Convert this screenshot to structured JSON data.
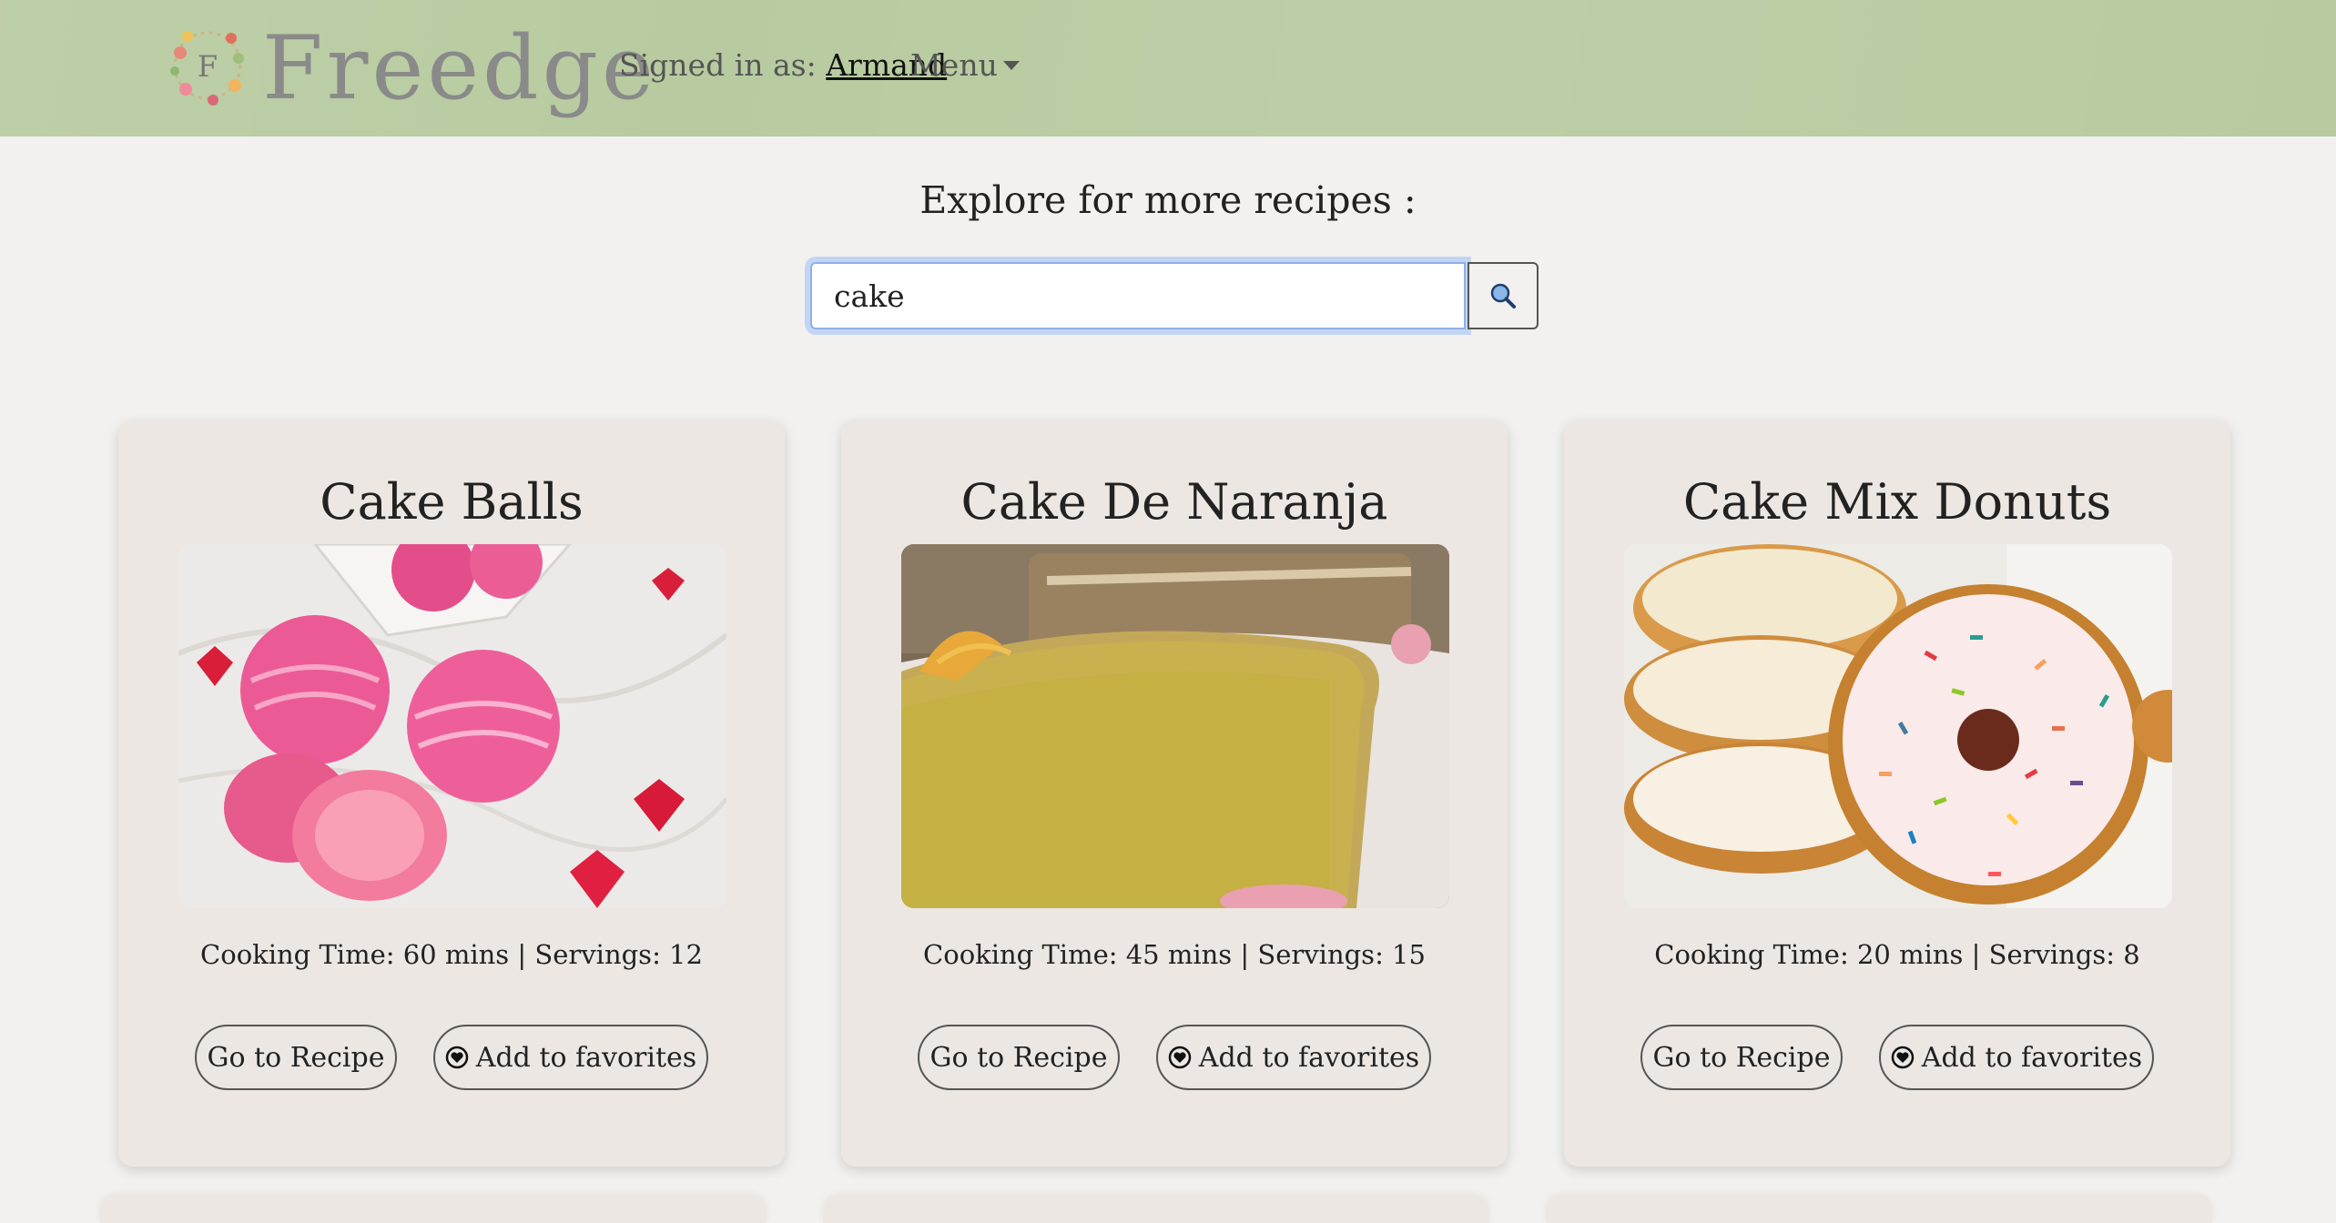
{
  "header": {
    "brand": "Freedge",
    "logo_letter": "F",
    "signed_in_label": "Signed in as:",
    "user_name": "Armand",
    "menu_label": "Menu"
  },
  "explore": {
    "title": "Explore for more recipes :",
    "search_value": "cake",
    "search_icon": "search-icon"
  },
  "recipes": [
    {
      "title": "Cake Balls",
      "meta": "Cooking Time: 60 mins | Servings: 12",
      "go_label": "Go to Recipe",
      "fav_label": "Add to favorites"
    },
    {
      "title": "Cake De Naranja",
      "meta": "Cooking Time: 45 mins | Servings: 15",
      "go_label": "Go to Recipe",
      "fav_label": "Add to favorites"
    },
    {
      "title": "Cake Mix Donuts",
      "meta": "Cooking Time: 20 mins | Servings: 8",
      "go_label": "Go to Recipe",
      "fav_label": "Add to favorites"
    }
  ],
  "colors": {
    "header_bg": "#b8cba0",
    "page_bg": "#f2f1ef",
    "card_bg": "#ece7e3",
    "search_focus": "#8fb0e6"
  }
}
